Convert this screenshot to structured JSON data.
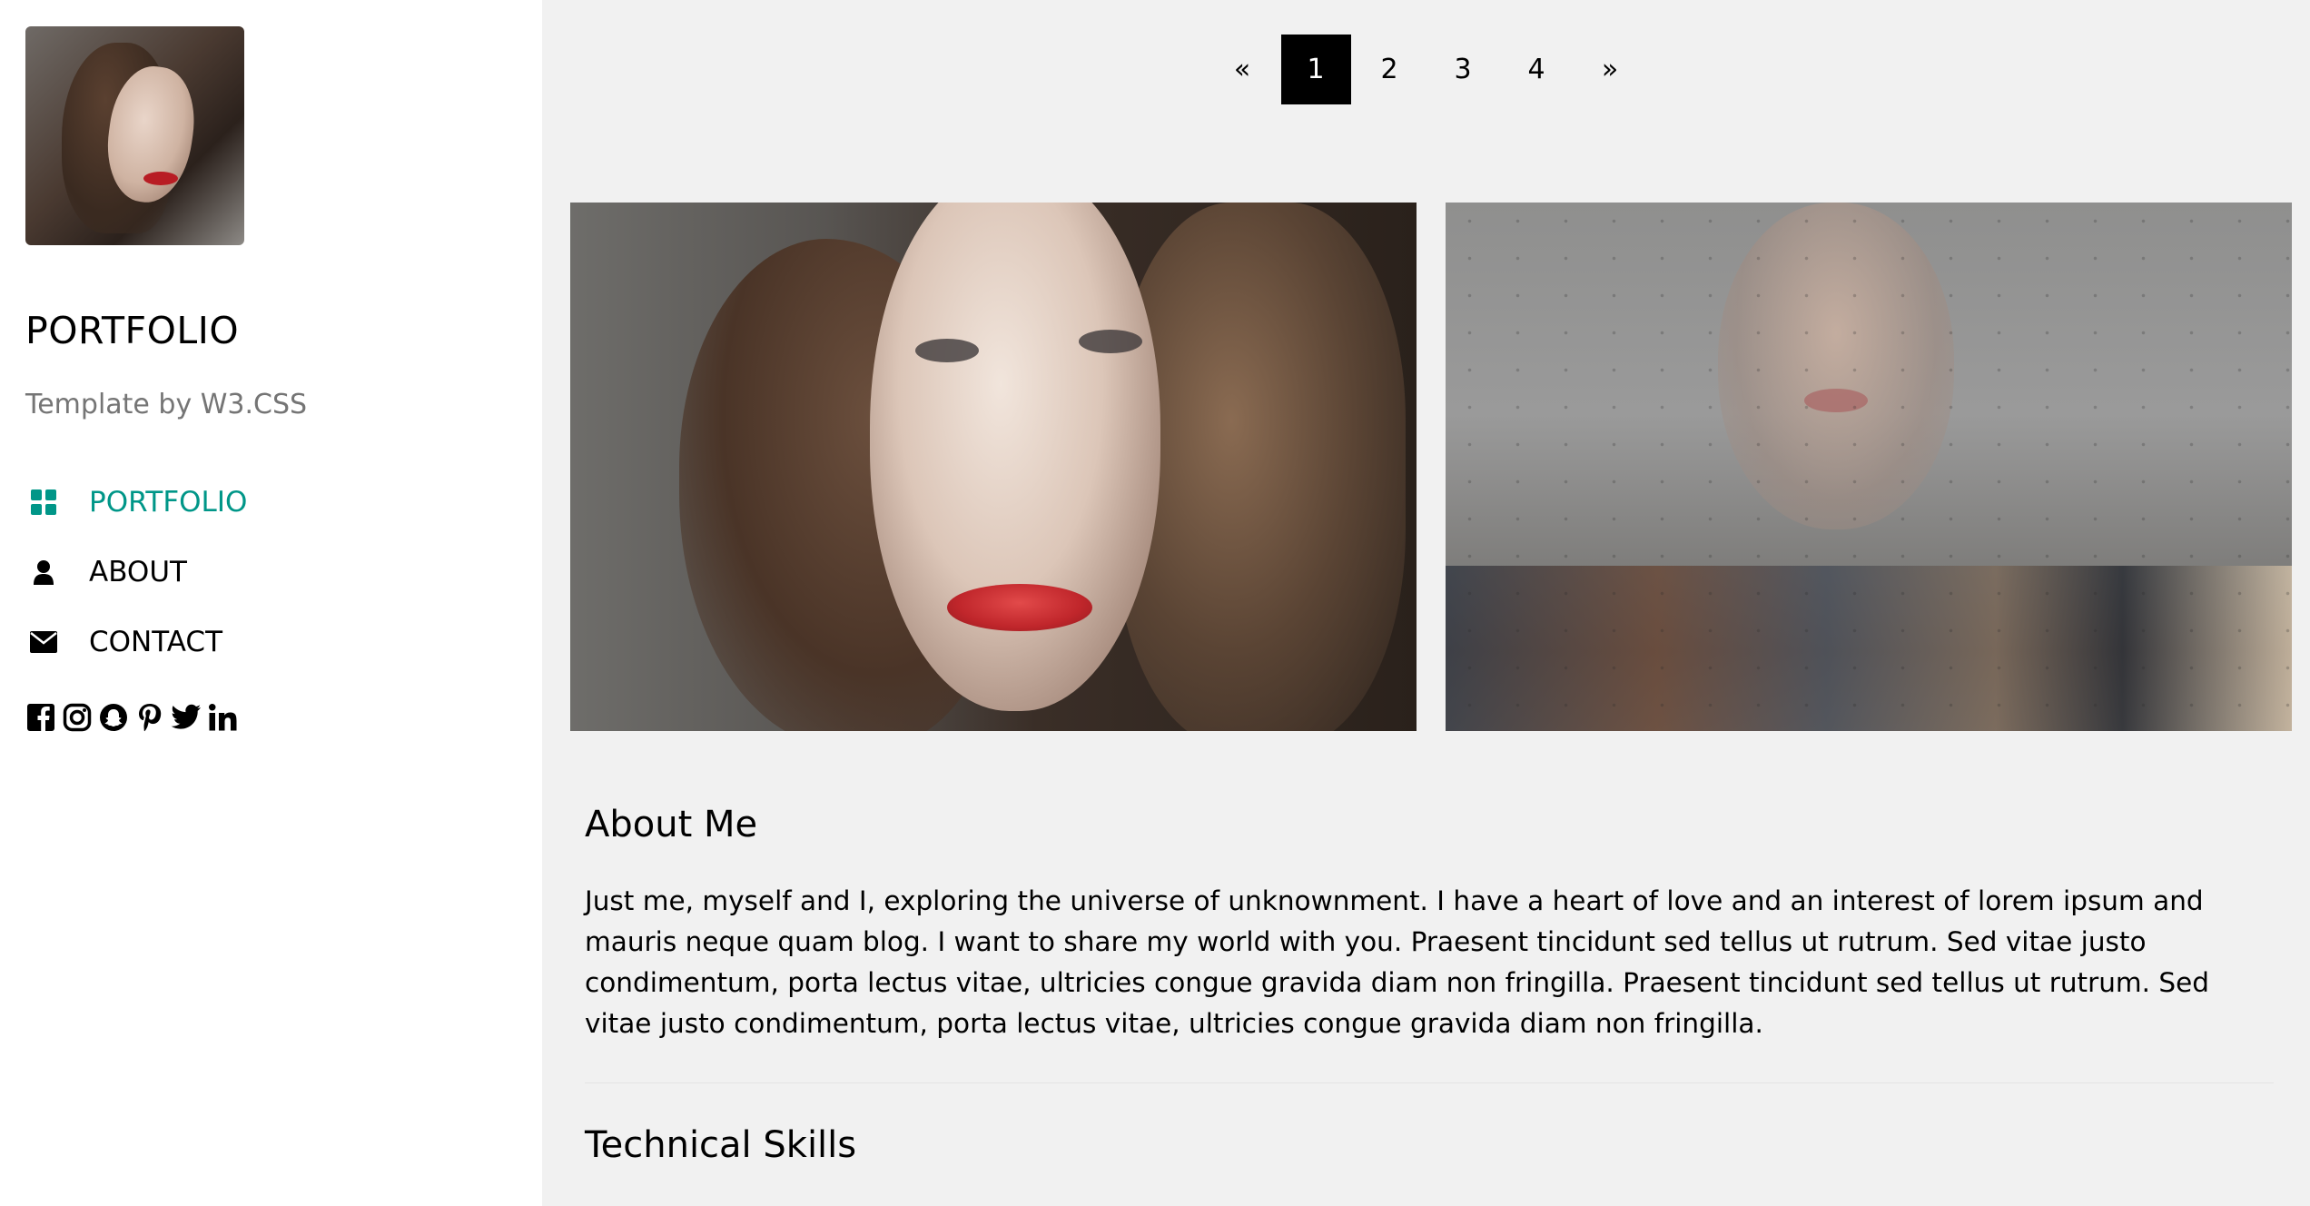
{
  "sidebar": {
    "brand": "PORTFOLIO",
    "byline": "Template by W3.CSS",
    "nav": [
      {
        "label": "PORTFOLIO",
        "icon": "grid-icon",
        "active": true
      },
      {
        "label": "ABOUT",
        "icon": "user-icon",
        "active": false
      },
      {
        "label": "CONTACT",
        "icon": "envelope-icon",
        "active": false
      }
    ],
    "socials": [
      "facebook-icon",
      "instagram-icon",
      "snapchat-icon",
      "pinterest-icon",
      "twitter-icon",
      "linkedin-icon"
    ]
  },
  "pagination": {
    "prev": "«",
    "pages": [
      "1",
      "2",
      "3",
      "4"
    ],
    "active_page": "1",
    "next": "»"
  },
  "about": {
    "title": "About Me",
    "text": "Just me, myself and I, exploring the universe of unknownment. I have a heart of love and an interest of lorem ipsum and mauris neque quam blog. I want to share my world with you. Praesent tincidunt sed tellus ut rutrum. Sed vitae justo condimentum, porta lectus vitae, ultricies congue gravida diam non fringilla. Praesent tincidunt sed tellus ut rutrum. Sed vitae justo condimentum, porta lectus vitae, ultricies congue gravida diam non fringilla."
  },
  "skills": {
    "title": "Technical Skills"
  },
  "colors": {
    "accent": "#009688",
    "sidebar_bg": "#ffffff",
    "main_bg": "#f1f1f1",
    "byline": "#757575"
  }
}
